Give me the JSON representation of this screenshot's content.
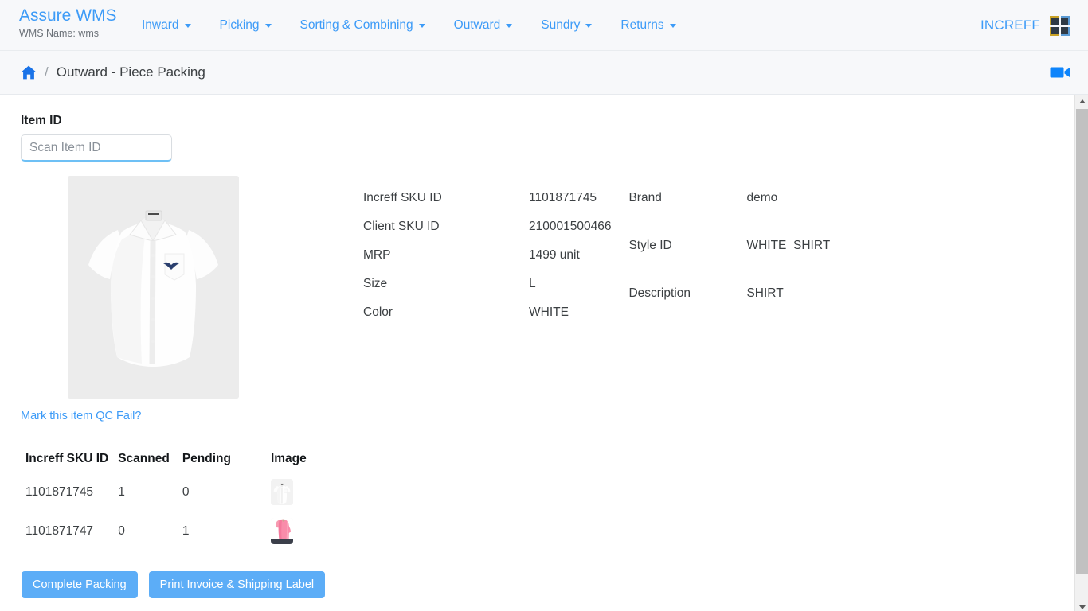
{
  "navbar": {
    "brand_title": "Assure WMS",
    "brand_subtitle": "WMS Name: wms",
    "menu": [
      {
        "label": "Inward"
      },
      {
        "label": "Picking"
      },
      {
        "label": "Sorting & Combining"
      },
      {
        "label": "Outward"
      },
      {
        "label": "Sundry"
      },
      {
        "label": "Returns"
      }
    ],
    "org_label": "INCREFF",
    "colors": {
      "link": "#3d9bf7",
      "background": "#f7f8fa"
    }
  },
  "breadcrumb": {
    "home_icon": "home-icon",
    "separator": "/",
    "title": "Outward - Piece Packing",
    "video_icon": "video-camera-icon"
  },
  "form": {
    "item_id_label": "Item ID",
    "item_id_value": "",
    "item_id_placeholder": "Scan Item ID"
  },
  "product": {
    "image_alt": "white-short-sleeve-shirt",
    "qc_fail_link": "Mark this item QC Fail?",
    "details_left": [
      {
        "key": "Increff SKU ID",
        "value": "1101871745"
      },
      {
        "key": "Client SKU ID",
        "value": "210001500466"
      },
      {
        "key": "MRP",
        "value": "1499 unit"
      },
      {
        "key": "Size",
        "value": "L"
      },
      {
        "key": "Color",
        "value": "WHITE"
      }
    ],
    "details_right": [
      {
        "key": "Brand",
        "value": "demo"
      },
      {
        "key": "Style ID",
        "value": "WHITE_SHIRT"
      },
      {
        "key": "Description",
        "value": "SHIRT"
      }
    ]
  },
  "table": {
    "columns": [
      "Increff SKU ID",
      "Scanned",
      "Pending",
      "Image"
    ],
    "rows": [
      {
        "sku": "1101871745",
        "scanned": "1",
        "pending": "0",
        "image_alt": "white-shirt-thumbnail"
      },
      {
        "sku": "1101871747",
        "scanned": "0",
        "pending": "1",
        "image_alt": "pink-top-thumbnail"
      }
    ]
  },
  "actions": {
    "complete_packing": "Complete Packing",
    "print_invoice": "Print Invoice & Shipping Label",
    "button_color": "#5cadf7"
  },
  "scrollbar": {
    "up_arrow": "scroll-up-arrow",
    "down_arrow": "scroll-down-arrow"
  }
}
